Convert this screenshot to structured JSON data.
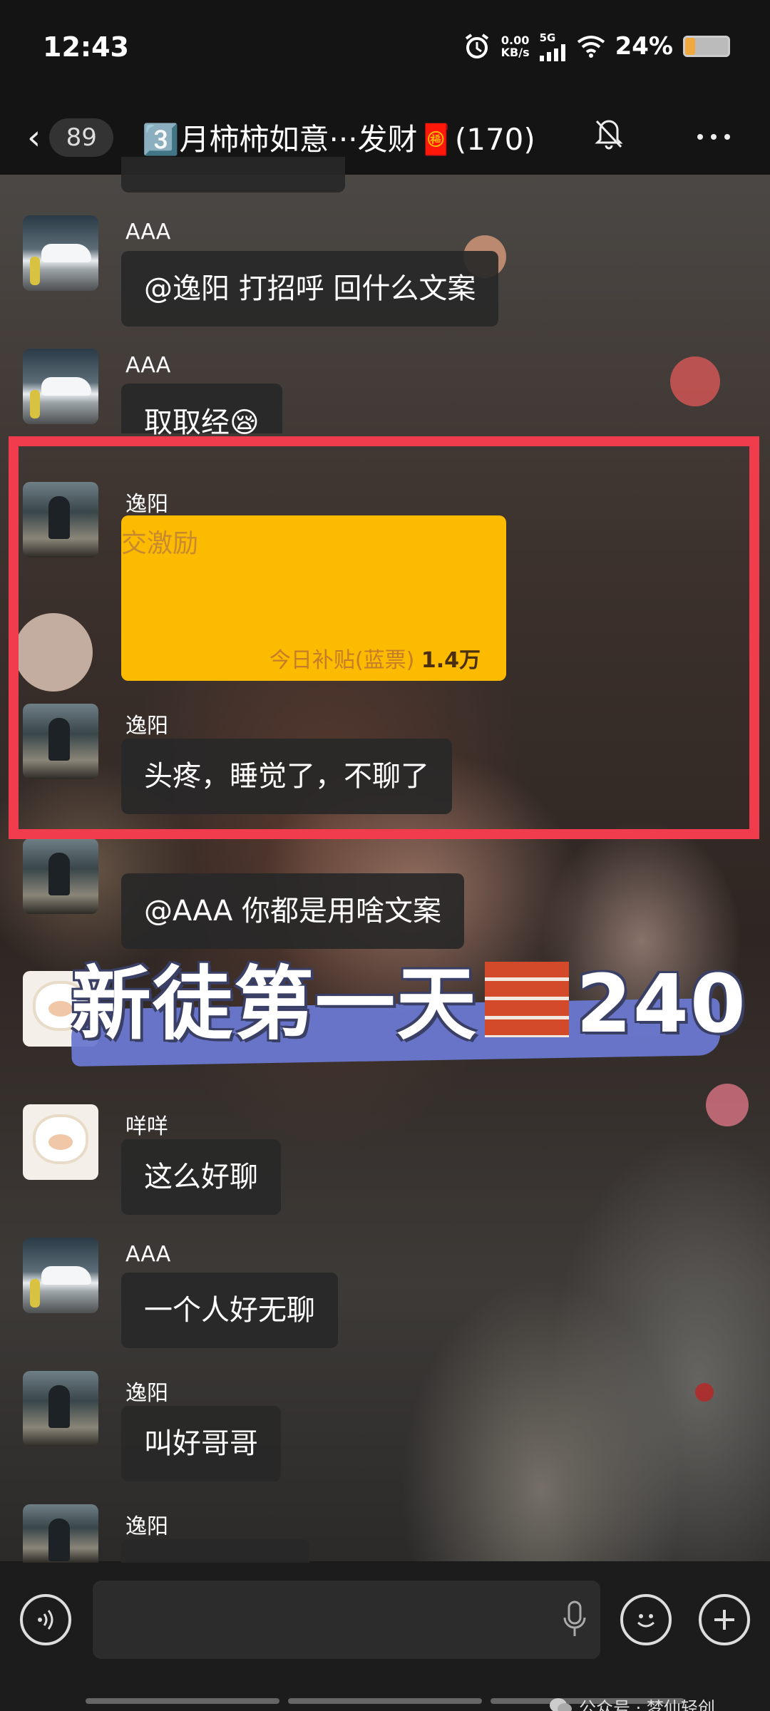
{
  "status_bar": {
    "time": "12:43",
    "net_speed_value": "0.00",
    "net_speed_unit": "KB/s",
    "network": "5G",
    "battery": "24%",
    "battery_level": 0.24
  },
  "header": {
    "unread_count": "89",
    "title": "3️⃣月柿柿如意···发财🧧(170)"
  },
  "messages": [
    {
      "sender": "AAA",
      "text": "@逸阳  打招呼  回什么文案",
      "avatar": "car-avatar"
    },
    {
      "sender": "AAA",
      "text": "取取经😪",
      "avatar": "car-avatar"
    },
    {
      "sender": "逸阳",
      "card_top": "交激励",
      "card_label": "今日补贴(蓝票)",
      "card_value": "1.4万",
      "avatar": "man-avatar"
    },
    {
      "sender": "逸阳",
      "text": "头疼，睡觉了，不聊了",
      "avatar": "man-avatar"
    },
    {
      "sender": "逸阳",
      "text": "@AAA 你都是用啥文案",
      "avatar": "man-avatar"
    },
    {
      "sender": "咩咩",
      "text": "这么好聊",
      "avatar": "sheep-avatar"
    },
    {
      "sender": "AAA",
      "text": "一个人好无聊",
      "avatar": "car-avatar"
    },
    {
      "sender": "逸阳",
      "text": "叫好哥哥",
      "avatar": "man-avatar"
    },
    {
      "sender": "逸阳",
      "avatar": "man-avatar"
    }
  ],
  "overlay": {
    "prefix": "新徒第一天",
    "number": "240"
  },
  "watermark": {
    "label": "公众号 · 梦仙轻创"
  },
  "colors": {
    "highlight_box": "#f03c4c",
    "card_bg": "#fdbb00",
    "brush": "#6a78d0"
  }
}
